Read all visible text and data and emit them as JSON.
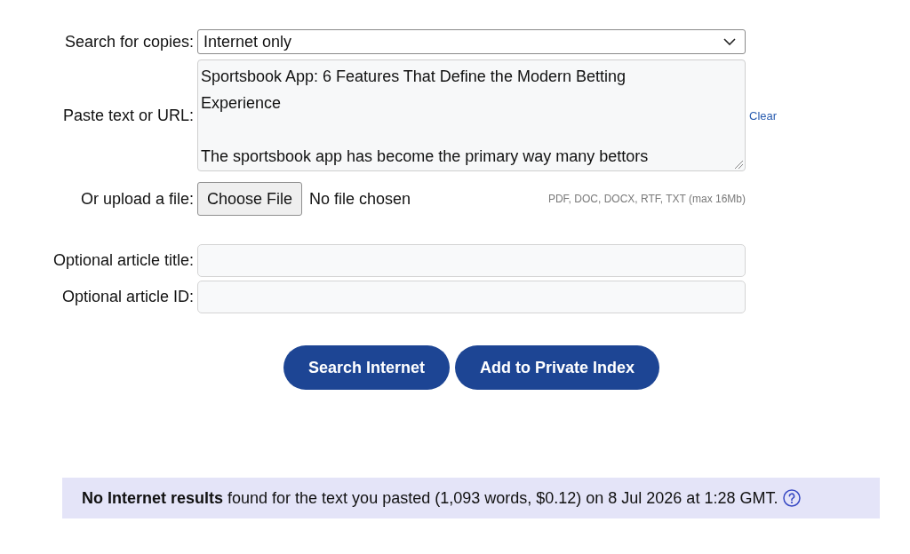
{
  "form": {
    "fields": [
      {
        "kind": "select",
        "label": "Search for copies:",
        "value": "Internet only"
      },
      {
        "kind": "textarea",
        "label": "Paste text or URL:",
        "paragraphs": [
          "Sportsbook App: 6 Features That Define the Modern Betting Experience",
          "The sportsbook app has become the primary way many bettors"
        ],
        "link": "Clear"
      },
      {
        "kind": "file",
        "label": "Or upload a file:",
        "button": "Choose File",
        "status": "No file chosen",
        "hint": "PDF, DOC, DOCX, RTF, TXT (max 16Mb)"
      },
      {
        "kind": "text",
        "label": "Optional article title:"
      },
      {
        "kind": "text",
        "label": "Optional article ID:"
      }
    ],
    "buttons": [
      "Search Internet",
      "Add to Private Index"
    ]
  },
  "result_banner": {
    "text": "**No Internet results** found for the text you pasted (1,093 words, $0.12) on 8 Jul 2026 at 1:28 GMT."
  }
}
